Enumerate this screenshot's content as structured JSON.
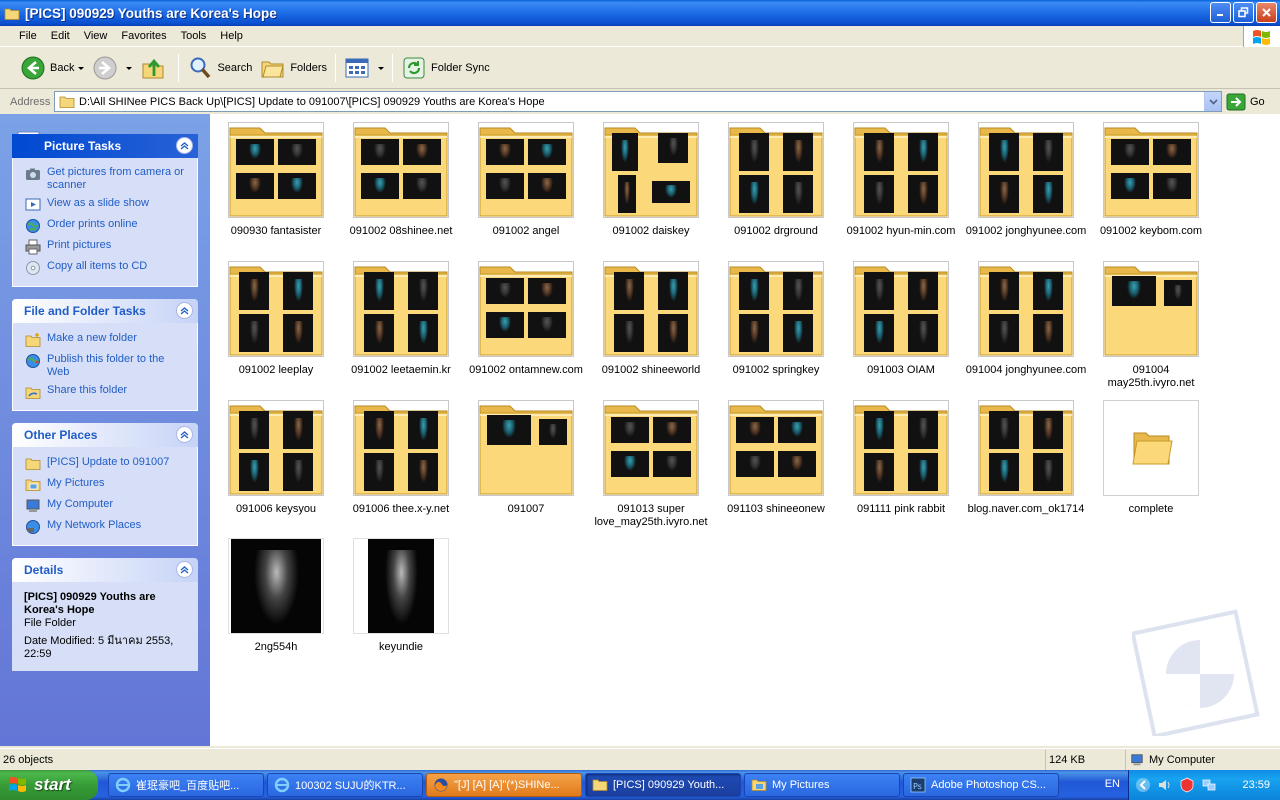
{
  "window": {
    "title": "[PICS] 090929 Youths are Korea's Hope"
  },
  "menu": [
    "File",
    "Edit",
    "View",
    "Favorites",
    "Tools",
    "Help"
  ],
  "toolbar": {
    "back_label": "Back",
    "search_label": "Search",
    "folders_label": "Folders",
    "foldersync_label": "Folder Sync"
  },
  "address": {
    "label": "Address",
    "value": "D:\\All SHINee PICS Back Up\\[PICS] Update to 091007\\[PICS] 090929 Youths are Korea's Hope",
    "go_label": "Go"
  },
  "picture_tasks": {
    "title": "Picture Tasks",
    "items": [
      {
        "label": "Get pictures from camera or scanner",
        "icon": "camera-icon"
      },
      {
        "label": "View as a slide show",
        "icon": "slideshow-icon"
      },
      {
        "label": "Order prints online",
        "icon": "globe-icon"
      },
      {
        "label": "Print pictures",
        "icon": "printer-icon"
      },
      {
        "label": "Copy all items to CD",
        "icon": "cd-icon"
      }
    ]
  },
  "file_tasks": {
    "title": "File and Folder Tasks",
    "items": [
      {
        "label": "Make a new folder",
        "icon": "new-folder-icon"
      },
      {
        "label": "Publish this folder to the Web",
        "icon": "publish-icon"
      },
      {
        "label": "Share this folder",
        "icon": "share-icon"
      }
    ]
  },
  "other_places": {
    "title": "Other Places",
    "items": [
      {
        "label": "[PICS] Update to 091007",
        "icon": "folder-icon"
      },
      {
        "label": "My Pictures",
        "icon": "my-pictures-icon"
      },
      {
        "label": "My Computer",
        "icon": "my-computer-icon"
      },
      {
        "label": "My Network Places",
        "icon": "network-icon"
      }
    ]
  },
  "details": {
    "title": "Details",
    "name": "[PICS] 090929 Youths are Korea's Hope",
    "type": "File Folder",
    "modified": "Date Modified: 5 มีนาคม 2553, 22:59"
  },
  "items": [
    {
      "label": "090930 fantasister",
      "kind": "folder",
      "layout": "grid4"
    },
    {
      "label": "091002 08shinee.net",
      "kind": "folder",
      "layout": "grid4"
    },
    {
      "label": "091002 angel",
      "kind": "folder",
      "layout": "grid4"
    },
    {
      "label": "091002 daiskey",
      "kind": "folder",
      "layout": "tall3"
    },
    {
      "label": "091002 drground",
      "kind": "folder",
      "layout": "tall4"
    },
    {
      "label": "091002 hyun-min.com",
      "kind": "folder",
      "layout": "tall4"
    },
    {
      "label": "091002 jonghyunee.com",
      "kind": "folder",
      "layout": "tall4"
    },
    {
      "label": "091002 keybom.com",
      "kind": "folder",
      "layout": "grid4"
    },
    {
      "label": "091002 leeplay",
      "kind": "folder",
      "layout": "tall4"
    },
    {
      "label": "091002 leetaemin.kr",
      "kind": "folder",
      "layout": "tall4"
    },
    {
      "label": "091002 ontamnew.com",
      "kind": "folder",
      "layout": "grid4"
    },
    {
      "label": "091002 shineeworld",
      "kind": "folder",
      "layout": "tall4"
    },
    {
      "label": "091002 springkey",
      "kind": "folder",
      "layout": "tall4"
    },
    {
      "label": "091003 OIAM",
      "kind": "folder",
      "layout": "tall4"
    },
    {
      "label": "091004 jonghyunee.com",
      "kind": "folder",
      "layout": "tall4"
    },
    {
      "label": "091004 may25th.ivyro.net",
      "kind": "folder",
      "layout": "two"
    },
    {
      "label": "091006 keysyou",
      "kind": "folder",
      "layout": "tall4"
    },
    {
      "label": "091006 thee.x-y.net",
      "kind": "folder",
      "layout": "tall4"
    },
    {
      "label": "091007",
      "kind": "folder",
      "layout": "two"
    },
    {
      "label": "091013 super love_may25th.ivyro.net",
      "kind": "folder",
      "layout": "grid4"
    },
    {
      "label": "091103 shineeonew",
      "kind": "folder",
      "layout": "grid4"
    },
    {
      "label": "091111 pink rabbit",
      "kind": "folder",
      "layout": "tall4"
    },
    {
      "label": "blog.naver.com_ok1714",
      "kind": "folder",
      "layout": "tall4"
    },
    {
      "label": "complete",
      "kind": "empty-folder",
      "layout": "none"
    },
    {
      "label": "2ng554h",
      "kind": "image",
      "layout": "photo"
    },
    {
      "label": "keyundie",
      "kind": "image",
      "layout": "photo-tall"
    }
  ],
  "status": {
    "objects": "26 objects",
    "size": "124 KB",
    "zone": "My Computer"
  },
  "taskbar": {
    "start_label": "start",
    "items": [
      {
        "label": "崔珉豪吧_百度贴吧...",
        "icon": "ie-icon",
        "style": "normal"
      },
      {
        "label": "100302 SUJU的KTR...",
        "icon": "ie-icon",
        "style": "normal"
      },
      {
        "label": "\"[J] [A] [A]\"(*)SHINe...",
        "icon": "firefox-icon",
        "style": "orange"
      },
      {
        "label": "[PICS] 090929 Youth...",
        "icon": "folder-icon",
        "style": "active"
      },
      {
        "label": "My Pictures",
        "icon": "my-pictures-icon",
        "style": "normal"
      },
      {
        "label": "Adobe Photoshop CS...",
        "icon": "photoshop-icon",
        "style": "normal"
      }
    ],
    "lang": "EN",
    "clock": "23:59"
  },
  "colors": {
    "titlebar": "#0a5fd8",
    "taskpane": "#6f8fe0",
    "link": "#215dc6",
    "start": "#3a9a3a"
  }
}
